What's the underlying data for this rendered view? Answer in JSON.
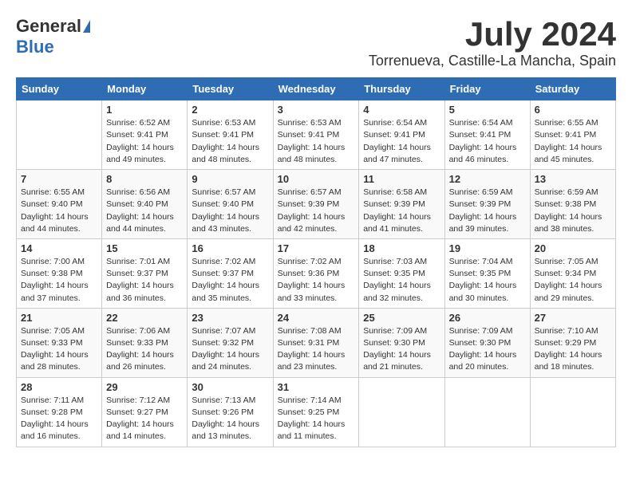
{
  "header": {
    "logo_general": "General",
    "logo_blue": "Blue",
    "month_title": "July 2024",
    "location": "Torrenueva, Castille-La Mancha, Spain"
  },
  "days_of_week": [
    "Sunday",
    "Monday",
    "Tuesday",
    "Wednesday",
    "Thursday",
    "Friday",
    "Saturday"
  ],
  "weeks": [
    [
      {
        "day": "",
        "sunrise": "",
        "sunset": "",
        "daylight": ""
      },
      {
        "day": "1",
        "sunrise": "Sunrise: 6:52 AM",
        "sunset": "Sunset: 9:41 PM",
        "daylight": "Daylight: 14 hours and 49 minutes."
      },
      {
        "day": "2",
        "sunrise": "Sunrise: 6:53 AM",
        "sunset": "Sunset: 9:41 PM",
        "daylight": "Daylight: 14 hours and 48 minutes."
      },
      {
        "day": "3",
        "sunrise": "Sunrise: 6:53 AM",
        "sunset": "Sunset: 9:41 PM",
        "daylight": "Daylight: 14 hours and 48 minutes."
      },
      {
        "day": "4",
        "sunrise": "Sunrise: 6:54 AM",
        "sunset": "Sunset: 9:41 PM",
        "daylight": "Daylight: 14 hours and 47 minutes."
      },
      {
        "day": "5",
        "sunrise": "Sunrise: 6:54 AM",
        "sunset": "Sunset: 9:41 PM",
        "daylight": "Daylight: 14 hours and 46 minutes."
      },
      {
        "day": "6",
        "sunrise": "Sunrise: 6:55 AM",
        "sunset": "Sunset: 9:41 PM",
        "daylight": "Daylight: 14 hours and 45 minutes."
      }
    ],
    [
      {
        "day": "7",
        "sunrise": "Sunrise: 6:55 AM",
        "sunset": "Sunset: 9:40 PM",
        "daylight": "Daylight: 14 hours and 44 minutes."
      },
      {
        "day": "8",
        "sunrise": "Sunrise: 6:56 AM",
        "sunset": "Sunset: 9:40 PM",
        "daylight": "Daylight: 14 hours and 44 minutes."
      },
      {
        "day": "9",
        "sunrise": "Sunrise: 6:57 AM",
        "sunset": "Sunset: 9:40 PM",
        "daylight": "Daylight: 14 hours and 43 minutes."
      },
      {
        "day": "10",
        "sunrise": "Sunrise: 6:57 AM",
        "sunset": "Sunset: 9:39 PM",
        "daylight": "Daylight: 14 hours and 42 minutes."
      },
      {
        "day": "11",
        "sunrise": "Sunrise: 6:58 AM",
        "sunset": "Sunset: 9:39 PM",
        "daylight": "Daylight: 14 hours and 41 minutes."
      },
      {
        "day": "12",
        "sunrise": "Sunrise: 6:59 AM",
        "sunset": "Sunset: 9:39 PM",
        "daylight": "Daylight: 14 hours and 39 minutes."
      },
      {
        "day": "13",
        "sunrise": "Sunrise: 6:59 AM",
        "sunset": "Sunset: 9:38 PM",
        "daylight": "Daylight: 14 hours and 38 minutes."
      }
    ],
    [
      {
        "day": "14",
        "sunrise": "Sunrise: 7:00 AM",
        "sunset": "Sunset: 9:38 PM",
        "daylight": "Daylight: 14 hours and 37 minutes."
      },
      {
        "day": "15",
        "sunrise": "Sunrise: 7:01 AM",
        "sunset": "Sunset: 9:37 PM",
        "daylight": "Daylight: 14 hours and 36 minutes."
      },
      {
        "day": "16",
        "sunrise": "Sunrise: 7:02 AM",
        "sunset": "Sunset: 9:37 PM",
        "daylight": "Daylight: 14 hours and 35 minutes."
      },
      {
        "day": "17",
        "sunrise": "Sunrise: 7:02 AM",
        "sunset": "Sunset: 9:36 PM",
        "daylight": "Daylight: 14 hours and 33 minutes."
      },
      {
        "day": "18",
        "sunrise": "Sunrise: 7:03 AM",
        "sunset": "Sunset: 9:35 PM",
        "daylight": "Daylight: 14 hours and 32 minutes."
      },
      {
        "day": "19",
        "sunrise": "Sunrise: 7:04 AM",
        "sunset": "Sunset: 9:35 PM",
        "daylight": "Daylight: 14 hours and 30 minutes."
      },
      {
        "day": "20",
        "sunrise": "Sunrise: 7:05 AM",
        "sunset": "Sunset: 9:34 PM",
        "daylight": "Daylight: 14 hours and 29 minutes."
      }
    ],
    [
      {
        "day": "21",
        "sunrise": "Sunrise: 7:05 AM",
        "sunset": "Sunset: 9:33 PM",
        "daylight": "Daylight: 14 hours and 28 minutes."
      },
      {
        "day": "22",
        "sunrise": "Sunrise: 7:06 AM",
        "sunset": "Sunset: 9:33 PM",
        "daylight": "Daylight: 14 hours and 26 minutes."
      },
      {
        "day": "23",
        "sunrise": "Sunrise: 7:07 AM",
        "sunset": "Sunset: 9:32 PM",
        "daylight": "Daylight: 14 hours and 24 minutes."
      },
      {
        "day": "24",
        "sunrise": "Sunrise: 7:08 AM",
        "sunset": "Sunset: 9:31 PM",
        "daylight": "Daylight: 14 hours and 23 minutes."
      },
      {
        "day": "25",
        "sunrise": "Sunrise: 7:09 AM",
        "sunset": "Sunset: 9:30 PM",
        "daylight": "Daylight: 14 hours and 21 minutes."
      },
      {
        "day": "26",
        "sunrise": "Sunrise: 7:09 AM",
        "sunset": "Sunset: 9:30 PM",
        "daylight": "Daylight: 14 hours and 20 minutes."
      },
      {
        "day": "27",
        "sunrise": "Sunrise: 7:10 AM",
        "sunset": "Sunset: 9:29 PM",
        "daylight": "Daylight: 14 hours and 18 minutes."
      }
    ],
    [
      {
        "day": "28",
        "sunrise": "Sunrise: 7:11 AM",
        "sunset": "Sunset: 9:28 PM",
        "daylight": "Daylight: 14 hours and 16 minutes."
      },
      {
        "day": "29",
        "sunrise": "Sunrise: 7:12 AM",
        "sunset": "Sunset: 9:27 PM",
        "daylight": "Daylight: 14 hours and 14 minutes."
      },
      {
        "day": "30",
        "sunrise": "Sunrise: 7:13 AM",
        "sunset": "Sunset: 9:26 PM",
        "daylight": "Daylight: 14 hours and 13 minutes."
      },
      {
        "day": "31",
        "sunrise": "Sunrise: 7:14 AM",
        "sunset": "Sunset: 9:25 PM",
        "daylight": "Daylight: 14 hours and 11 minutes."
      },
      {
        "day": "",
        "sunrise": "",
        "sunset": "",
        "daylight": ""
      },
      {
        "day": "",
        "sunrise": "",
        "sunset": "",
        "daylight": ""
      },
      {
        "day": "",
        "sunrise": "",
        "sunset": "",
        "daylight": ""
      }
    ]
  ]
}
